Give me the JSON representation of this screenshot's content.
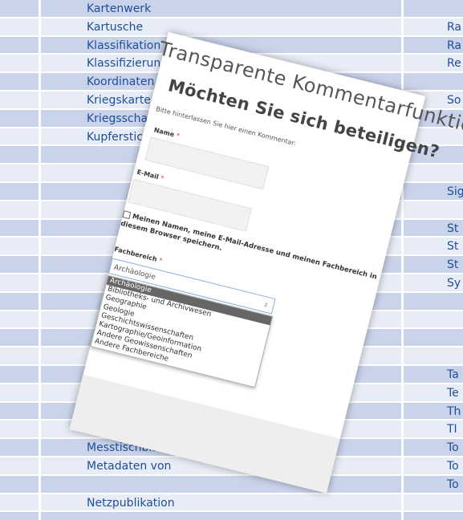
{
  "background_table": {
    "left_terms": [
      {
        "row": 0,
        "text": "Kartenwerk"
      },
      {
        "row": 1,
        "text": "Kartusche"
      },
      {
        "row": 2,
        "text": "Klassifikation"
      },
      {
        "row": 3,
        "text": "Klassifizierung"
      },
      {
        "row": 4,
        "text": "Koordinaten"
      },
      {
        "row": 5,
        "text": "Kriegskarte"
      },
      {
        "row": 6,
        "text": "Kriegsschauplatz"
      },
      {
        "row": 7,
        "text": "Kupferstich"
      },
      {
        "row": 24,
        "text": "Messtischblatt"
      },
      {
        "row": 25,
        "text": "Metadaten von"
      },
      {
        "row": 27,
        "text": "Netzpublikation"
      }
    ],
    "right_terms": [
      {
        "row": 1,
        "text": "Ra"
      },
      {
        "row": 2,
        "text": "Ra"
      },
      {
        "row": 3,
        "text": "Re"
      },
      {
        "row": 5,
        "text": "So"
      },
      {
        "row": 10,
        "text": "Sig"
      },
      {
        "row": 12,
        "text": "St"
      },
      {
        "row": 13,
        "text": "St"
      },
      {
        "row": 14,
        "text": "St"
      },
      {
        "row": 15,
        "text": "Sy"
      },
      {
        "row": 20,
        "text": "Ta"
      },
      {
        "row": 21,
        "text": "Te"
      },
      {
        "row": 22,
        "text": "Th"
      },
      {
        "row": 23,
        "text": "TI"
      },
      {
        "row": 24,
        "text": "To"
      },
      {
        "row": 25,
        "text": "To"
      },
      {
        "row": 26,
        "text": "To"
      }
    ],
    "colors": {
      "dark_row": "#c9d3ea",
      "light_row": "#e8ecf6",
      "link_text": "#1e4e9a"
    }
  },
  "form": {
    "title": "Transparente Kommentarfunktion",
    "subtitle": "Möchten Sie sich beteiligen?",
    "intro": "Bitte hinterlassen Sie hier einen Kommentar:",
    "name_label": "Name",
    "email_label": "E-Mail",
    "required_marker": "*",
    "checkbox_label": "Meinen Namen, meine E-Mail-Adresse und meinen Fachbereich in diesem Browser speichern.",
    "field_label": "Fachbereich",
    "select_value": "Archäologie",
    "options": [
      "Archäologie",
      "Bibliotheks- und Archivwesen",
      "Geographie",
      "Geologie",
      "Geschichtswissenschaften",
      "Kartographie/Geoinformation",
      "Andere Geowissenschaften",
      "Andere Fachbereiche"
    ],
    "selected_option_index": 0
  }
}
